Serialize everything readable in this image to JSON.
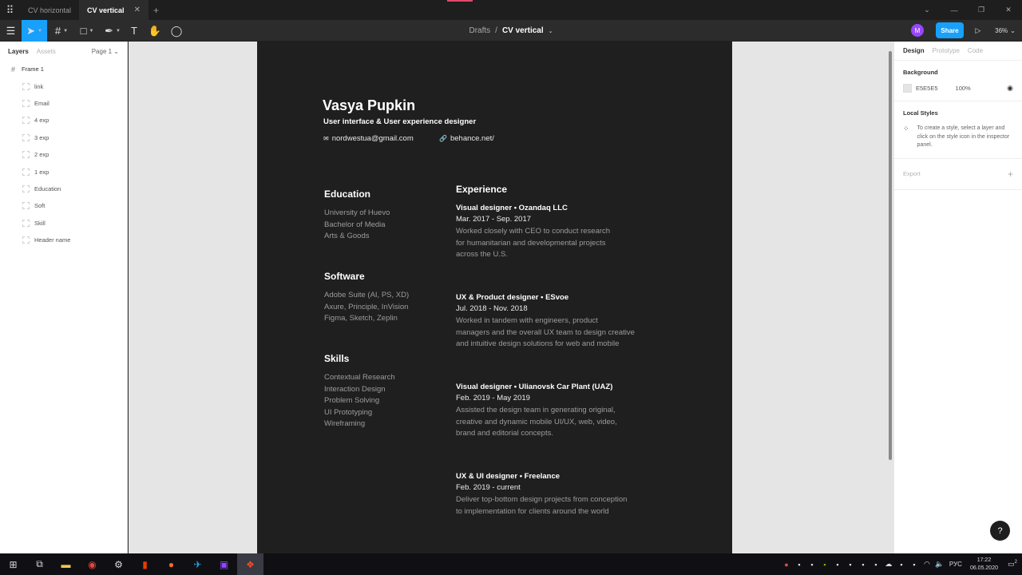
{
  "tabs": [
    {
      "label": "CV horizontal",
      "active": false
    },
    {
      "label": "CV vertical",
      "active": true
    }
  ],
  "toolbar": {
    "breadcrumb_parent": "Drafts",
    "breadcrumb_sep": "/",
    "file_name": "CV vertical",
    "avatar_initial": "M",
    "share_label": "Share",
    "zoom": "36%"
  },
  "layers_panel": {
    "tab_layers": "Layers",
    "tab_assets": "Assets",
    "page": "Page 1",
    "frame": "Frame 1",
    "children": [
      "link",
      "Email",
      "4 exp",
      "3 exp",
      "2 exp",
      "1 exp",
      "Education",
      "Soft",
      "Skill",
      "Header name"
    ]
  },
  "cv": {
    "name": "Vasya Pupkin",
    "role": "User interface & User experience designer",
    "email": "nordwestua@gmail.com",
    "link": "behance.net/",
    "education_title": "Education",
    "education": [
      "University of Huevo",
      "Bachelor of Media",
      "Arts & Goods"
    ],
    "software_title": "Software",
    "software": [
      "Adobe Suite (AI, PS, XD)",
      "Axure, Principle, InVision",
      "Figma, Sketch, Zeplin"
    ],
    "skills_title": "Skills",
    "skills": [
      "Contextual Research",
      "Interaction Design",
      "Problem Solving",
      "UI Prototyping",
      "Wireframing"
    ],
    "experience_title": "Experience",
    "experience": [
      {
        "title": "Visual designer • Ozandaq LLC",
        "dates": "Mar. 2017 - Sep. 2017",
        "desc": [
          "Worked closely with CEO to conduct research",
          "for humanitarian and developmental projects",
          "across the U.S."
        ]
      },
      {
        "title": "UX & Product designer • ESvoe",
        "dates": "Jul. 2018 - Nov. 2018",
        "desc": [
          "Worked in tandem with engineers, product",
          "managers and the overall UX team to design creative",
          "and intuitive design solutions for web and mobile"
        ]
      },
      {
        "title": "Visual designer • Ulianovsk Car Plant (UAZ)",
        "dates": "Feb. 2019 - May 2019",
        "desc": [
          "Assisted the design team in generating original,",
          "creative and dynamic mobile UI/UX, web, video,",
          "brand and editorial concepts."
        ]
      },
      {
        "title": "UX & UI designer • Freelance",
        "dates": "Feb. 2019 - current",
        "desc": [
          "Deliver top-bottom design projects from conception",
          "to implementation for clients around the world"
        ]
      }
    ]
  },
  "design_panel": {
    "tab_design": "Design",
    "tab_prototype": "Prototype",
    "tab_code": "Code",
    "background_title": "Background",
    "bg_hex": "E5E5E5",
    "bg_opacity": "100%",
    "local_styles_title": "Local Styles",
    "local_styles_hint": "To create a style, select a layer and click on the style icon in the inspector panel.",
    "export_title": "Export",
    "help": "?"
  },
  "taskbar": {
    "lang": "РУС",
    "time": "17:22",
    "date": "06.05.2020",
    "notif_count": "2"
  },
  "colors": {
    "accent": "#18a0fb",
    "canvas": "#e5e5e5",
    "cv_bg": "#1f1f1f"
  }
}
